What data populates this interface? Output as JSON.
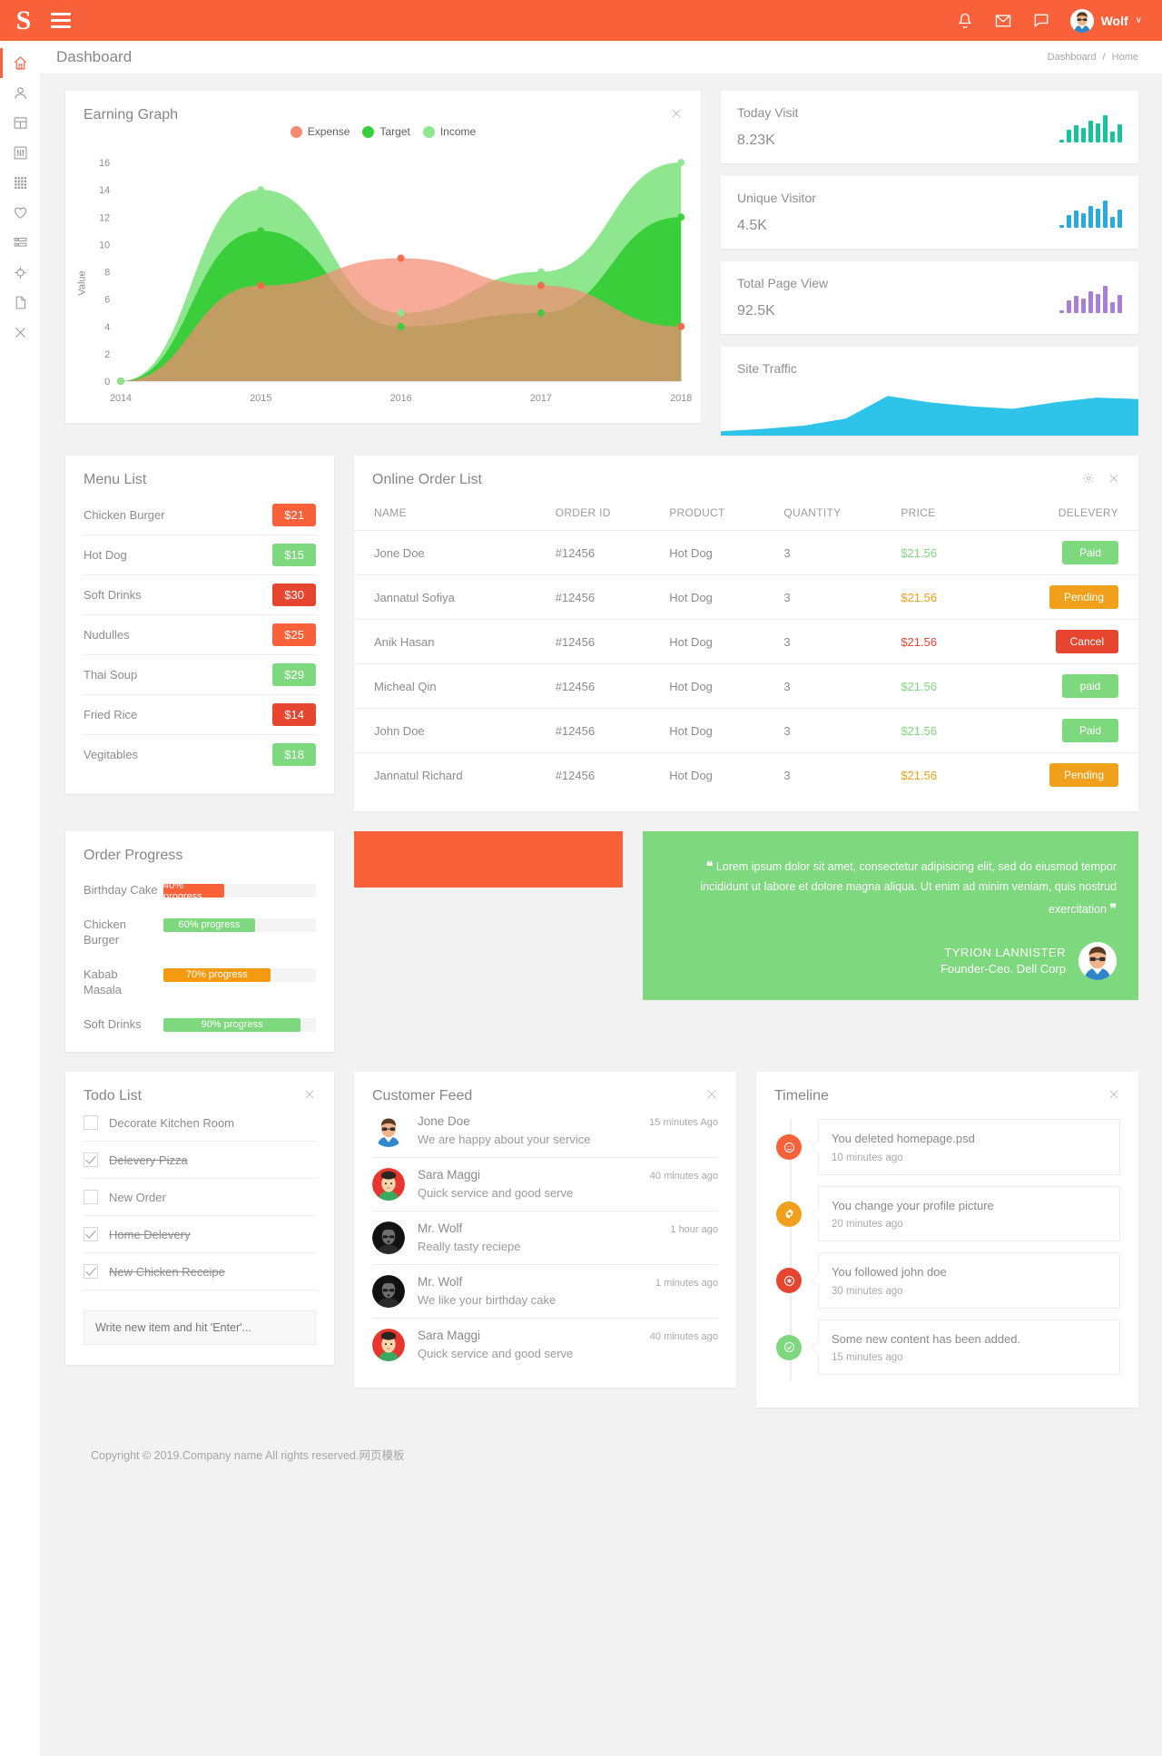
{
  "topbar": {
    "logo": "S",
    "menu_icon": "hamburger-icon",
    "icons": [
      "bell-icon",
      "envelope-icon",
      "chat-icon"
    ],
    "user_name": "Wolf",
    "caret": "∨"
  },
  "sidebar": {
    "items": [
      {
        "name": "home",
        "active": true
      },
      {
        "name": "user",
        "active": false
      },
      {
        "name": "layout",
        "active": false
      },
      {
        "name": "sliders",
        "active": false
      },
      {
        "name": "grid",
        "active": false
      },
      {
        "name": "heart",
        "active": false
      },
      {
        "name": "list",
        "active": false
      },
      {
        "name": "target",
        "active": false
      },
      {
        "name": "file",
        "active": false
      },
      {
        "name": "close",
        "active": false
      }
    ]
  },
  "header": {
    "title": "Dashboard",
    "breadcrumb": [
      "Dashboard",
      "Home"
    ],
    "separator": "/"
  },
  "earning_graph": {
    "title": "Earning Graph",
    "close_icon": "close-icon"
  },
  "chart_data": {
    "type": "area",
    "title": "Earning Graph",
    "xlabel": "",
    "ylabel": "Value",
    "x": [
      "2014",
      "2015",
      "2016",
      "2017",
      "2018"
    ],
    "ylim": [
      0,
      17
    ],
    "yticks": [
      0,
      2,
      4,
      6,
      8,
      10,
      12,
      14,
      16
    ],
    "grid": false,
    "legend_position": "top-center",
    "series": [
      {
        "name": "Expense",
        "color": "#f4674a",
        "fill": "#f78a73",
        "values": [
          0,
          7,
          9,
          7,
          4
        ]
      },
      {
        "name": "Target",
        "color": "#3ace3a",
        "fill": "#3ace3a",
        "values": [
          0,
          11,
          4,
          5,
          12
        ]
      },
      {
        "name": "Income",
        "color": "#8ee68e",
        "fill": "#8ee68e",
        "values": [
          0,
          14,
          5,
          8,
          16
        ]
      }
    ]
  },
  "stats": [
    {
      "label": "Today Visit",
      "value": "8.23K",
      "color": "#18c29c",
      "bars": [
        8,
        42,
        55,
        48,
        72,
        62,
        88,
        36,
        58
      ]
    },
    {
      "label": "Unique Visitor",
      "value": "4.5K",
      "color": "#2aa9e0",
      "bars": [
        8,
        42,
        55,
        48,
        72,
        62,
        88,
        36,
        58
      ]
    },
    {
      "label": "Total Page View",
      "value": "92.5K",
      "color": "#a97fd6",
      "bars": [
        8,
        42,
        55,
        48,
        72,
        62,
        88,
        36,
        58
      ]
    }
  ],
  "site_traffic": {
    "title": "Site Traffic",
    "color": "#2ec4ea",
    "points": [
      2,
      5,
      9,
      18,
      46,
      38,
      33,
      30,
      38,
      44,
      42
    ]
  },
  "menu_list": {
    "title": "Menu List",
    "items": [
      {
        "name": "Chicken Burger",
        "price": "$21",
        "color": "#f9613a"
      },
      {
        "name": "Hot Dog",
        "price": "$15",
        "color": "#7ed87e"
      },
      {
        "name": "Soft Drinks",
        "price": "$30",
        "color": "#e6452f"
      },
      {
        "name": "Nudulles",
        "price": "$25",
        "color": "#f9613a"
      },
      {
        "name": "Thai Soup",
        "price": "$29",
        "color": "#7ed87e"
      },
      {
        "name": "Fried Rice",
        "price": "$14",
        "color": "#e6452f"
      },
      {
        "name": "Vegitables",
        "price": "$18",
        "color": "#7ed87e"
      }
    ]
  },
  "order_list": {
    "title": "Online Order List",
    "settings_icon": "gear-icon",
    "close_icon": "close-icon",
    "columns": [
      "NAME",
      "ORDER ID",
      "PRODUCT",
      "QUANTITY",
      "PRICE",
      "DELEVERY"
    ],
    "rows": [
      {
        "name": "Jone Doe",
        "order_id": "#12456",
        "product": "Hot Dog",
        "quantity": "3",
        "price": "$21.56",
        "price_color": "#7ed87e",
        "status": "Paid",
        "status_color": "#7ed87e"
      },
      {
        "name": "Jannatul Sofiya",
        "order_id": "#12456",
        "product": "Hot Dog",
        "quantity": "3",
        "price": "$21.56",
        "price_color": "#f0a01a",
        "status": "Pending",
        "status_color": "#f0a01a"
      },
      {
        "name": "Anik Hasan",
        "order_id": "#12456",
        "product": "Hot Dog",
        "quantity": "3",
        "price": "$21.56",
        "price_color": "#e6452f",
        "status": "Cancel",
        "status_color": "#e6452f"
      },
      {
        "name": "Micheal Qin",
        "order_id": "#12456",
        "product": "Hot Dog",
        "quantity": "3",
        "price": "$21.56",
        "price_color": "#7ed87e",
        "status": "paid",
        "status_color": "#7ed87e"
      },
      {
        "name": "John Doe",
        "order_id": "#12456",
        "product": "Hot Dog",
        "quantity": "3",
        "price": "$21.56",
        "price_color": "#7ed87e",
        "status": "Paid",
        "status_color": "#7ed87e"
      },
      {
        "name": "Jannatul Richard",
        "order_id": "#12456",
        "product": "Hot Dog",
        "quantity": "3",
        "price": "$21.56",
        "price_color": "#f0a01a",
        "status": "Pending",
        "status_color": "#f0a01a"
      }
    ]
  },
  "order_progress": {
    "title": "Order Progress",
    "items": [
      {
        "label": "Birthday Cake",
        "text": "40% progress",
        "percent": 40,
        "color": "#f9613a"
      },
      {
        "label": "Chicken Burger",
        "text": "60% progress",
        "percent": 60,
        "color": "#7ed87e"
      },
      {
        "label": "Kabab Masala",
        "text": "70% progress",
        "percent": 70,
        "color": "#f49a10"
      },
      {
        "label": "Soft Drinks",
        "text": "90% progress",
        "percent": 90,
        "color": "#7ed87e"
      }
    ]
  },
  "testimonial": {
    "open_quote": "“",
    "close_quote": "”",
    "text": "Lorem ipsum dolor sit amet, consectetur adipisicing elit, sed do eiusmod tempor incididunt ut labore et dolore magna aliqua. Ut enim ad minim veniam, quis nostrud exercitation",
    "author": "TYRION LANNISTER",
    "role": "Founder-Ceo. Dell Corp",
    "bg_color": "#7ed87e"
  },
  "todo": {
    "title": "Todo List",
    "close_icon": "close-icon",
    "items": [
      {
        "text": "Decorate Kitchen Room",
        "done": false
      },
      {
        "text": "Delevery Pizza",
        "done": true
      },
      {
        "text": "New Order",
        "done": false
      },
      {
        "text": "Home Delevery",
        "done": true
      },
      {
        "text": "New Chicken Receipe",
        "done": true
      }
    ],
    "input_placeholder": "Write new item and hit 'Enter'...",
    "input_value": ""
  },
  "customer_feed": {
    "title": "Customer Feed",
    "close_icon": "close-icon",
    "items": [
      {
        "name": "Jone Doe",
        "time": "15 minutes Ago",
        "message": "We are happy about your service",
        "avatar": "man-glasses"
      },
      {
        "name": "Sara Maggi",
        "time": "40 minutes ago",
        "message": "Quick service and good serve",
        "avatar": "woman-red"
      },
      {
        "name": "Mr. Wolf",
        "time": "1 hour ago",
        "message": "Really tasty reciepe",
        "avatar": "man-dark"
      },
      {
        "name": "Mr. Wolf",
        "time": "1 minutes ago",
        "message": "We like your birthday cake",
        "avatar": "man-dark"
      },
      {
        "name": "Sara Maggi",
        "time": "40 minutes ago",
        "message": "Quick service and good serve",
        "avatar": "woman-red"
      }
    ]
  },
  "timeline": {
    "title": "Timeline",
    "close_icon": "close-icon",
    "items": [
      {
        "title": "You deleted homepage.psd",
        "time": "10 minutes ago",
        "color": "#f9613a",
        "icon": "smiley-icon"
      },
      {
        "title": "You change your profile picture",
        "time": "20 minutes ago",
        "color": "#f0a01a",
        "icon": "gear-icon"
      },
      {
        "title": "You followed john doe",
        "time": "30 minutes ago",
        "color": "#e6452f",
        "icon": "asterisk-icon"
      },
      {
        "title": "Some new content has been added.",
        "time": "15 minutes ago",
        "color": "#7ed87e",
        "icon": "check-circle-icon"
      }
    ]
  },
  "footer": {
    "text": "Copyright © 2019.Company name All rights reserved.网页模板"
  }
}
